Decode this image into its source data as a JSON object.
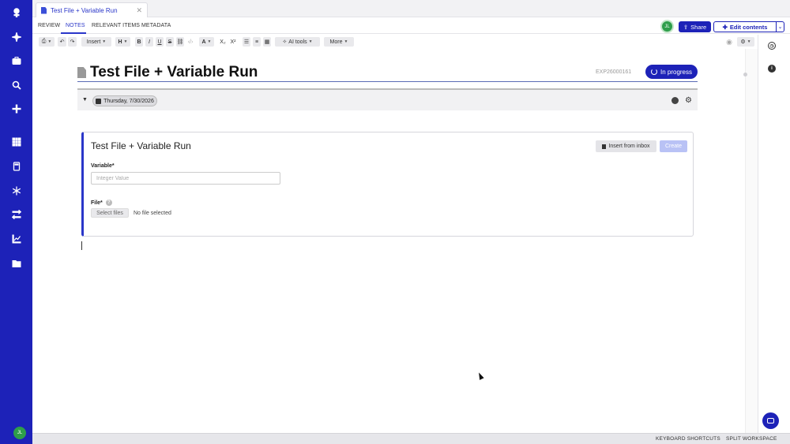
{
  "tab": {
    "title": "Test File + Variable Run"
  },
  "nav": {
    "tabs": [
      {
        "label": "REVIEW"
      },
      {
        "label": "NOTES"
      },
      {
        "label": "RELEVANT ITEMS"
      },
      {
        "label": "METADATA"
      }
    ],
    "avatar_initials": "JL",
    "share_label": "Share",
    "edit_label": "Edit contents"
  },
  "toolbar": {
    "insert_label": "Insert",
    "heading_label": "H",
    "bold": "B",
    "italic": "I",
    "underline": "U",
    "strike": "S",
    "font_color": "A",
    "subscript": "X₂",
    "superscript": "X²",
    "ai_tools_label": "AI tools",
    "more_label": "More"
  },
  "header": {
    "title": "Test File + Variable Run",
    "experiment_id": "EXP26000161",
    "status_label": "In progress"
  },
  "date_bar": {
    "date_label": "Thursday, 7/30/2026"
  },
  "form": {
    "title": "Test File + Variable Run",
    "insert_inbox_label": "Insert from inbox",
    "create_label": "Create",
    "variable_label": "Variable*",
    "variable_placeholder": "Integer Value",
    "file_label": "File*",
    "select_files_label": "Select files",
    "no_file_text": "No file selected"
  },
  "footer": {
    "keyboard_shortcuts": "KEYBOARD SHORTCUTS",
    "split_workspace": "SPLIT WORKSPACE"
  },
  "rail": {
    "avatar_initials": "JL"
  },
  "colors": {
    "brand": "#1d22b8",
    "accent": "#2a36c9",
    "avatar": "#2e9e4a",
    "create_disabled": "#b9c2f5"
  }
}
